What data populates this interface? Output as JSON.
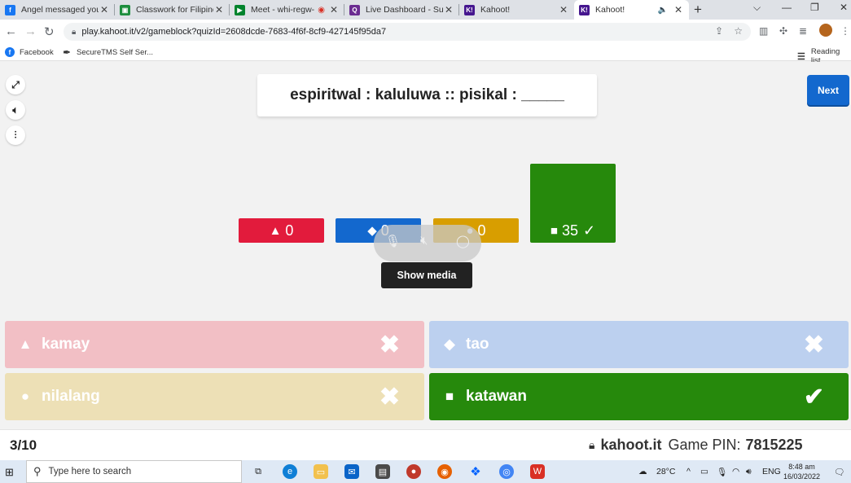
{
  "browser": {
    "tabs": [
      {
        "title": "Angel messaged you",
        "fav_color": "#1877f2",
        "fav_glyph": "f"
      },
      {
        "title": "Classwork for Filipino",
        "fav_color": "#1e8e3e",
        "fav_glyph": "▣"
      },
      {
        "title": "Meet - whi-regw-",
        "fav_color": "#00832d",
        "fav_glyph": "▶"
      },
      {
        "title": "Live Dashboard - Sun",
        "fav_color": "#6b2c91",
        "fav_glyph": "Q"
      },
      {
        "title": "Kahoot!",
        "fav_color": "#46178f",
        "fav_glyph": "K!"
      },
      {
        "title": "Kahoot!",
        "fav_color": "#46178f",
        "fav_glyph": "K!"
      }
    ],
    "url": "play.kahoot.it/v2/gameblock?quizId=2608dcde-7683-4f6f-8cf9-427145f95da7",
    "bookmarks": [
      {
        "label": "Facebook"
      },
      {
        "label": "SecureTMS Self Ser..."
      }
    ],
    "reading_list": "Reading list"
  },
  "game": {
    "question": "espiritwal : kaluluwa :: pisikal : _____",
    "next_label": "Next",
    "results": [
      {
        "symbol": "▲",
        "count": "0",
        "color": "#e21b3c"
      },
      {
        "symbol": "◆",
        "count": "0",
        "color": "#1368ce"
      },
      {
        "symbol": "●",
        "count": "0",
        "color": "#d89e00"
      },
      {
        "symbol": "■",
        "count": "35",
        "color": "#26890c",
        "check": "✓"
      }
    ],
    "show_media_label": "Show media",
    "answers": [
      {
        "symbol": "▲",
        "text": "kamay",
        "mark": "✖",
        "color": "#f2bfc5"
      },
      {
        "symbol": "◆",
        "text": "tao",
        "mark": "✖",
        "color": "#bcd0ef"
      },
      {
        "symbol": "●",
        "text": "nilalang",
        "mark": "✖",
        "color": "#ede0b6"
      },
      {
        "symbol": "■",
        "text": "katawan",
        "mark": "✔",
        "color": "#26890c"
      }
    ]
  },
  "footer": {
    "progress": "3/10",
    "brand": "kahoot.it",
    "pin_label": "Game PIN:",
    "pin": "7815225"
  },
  "taskbar": {
    "search_placeholder": "Type here to search",
    "weather": "28°C",
    "language": "ENG",
    "time": "8:48 am",
    "date": "16/03/2022"
  }
}
